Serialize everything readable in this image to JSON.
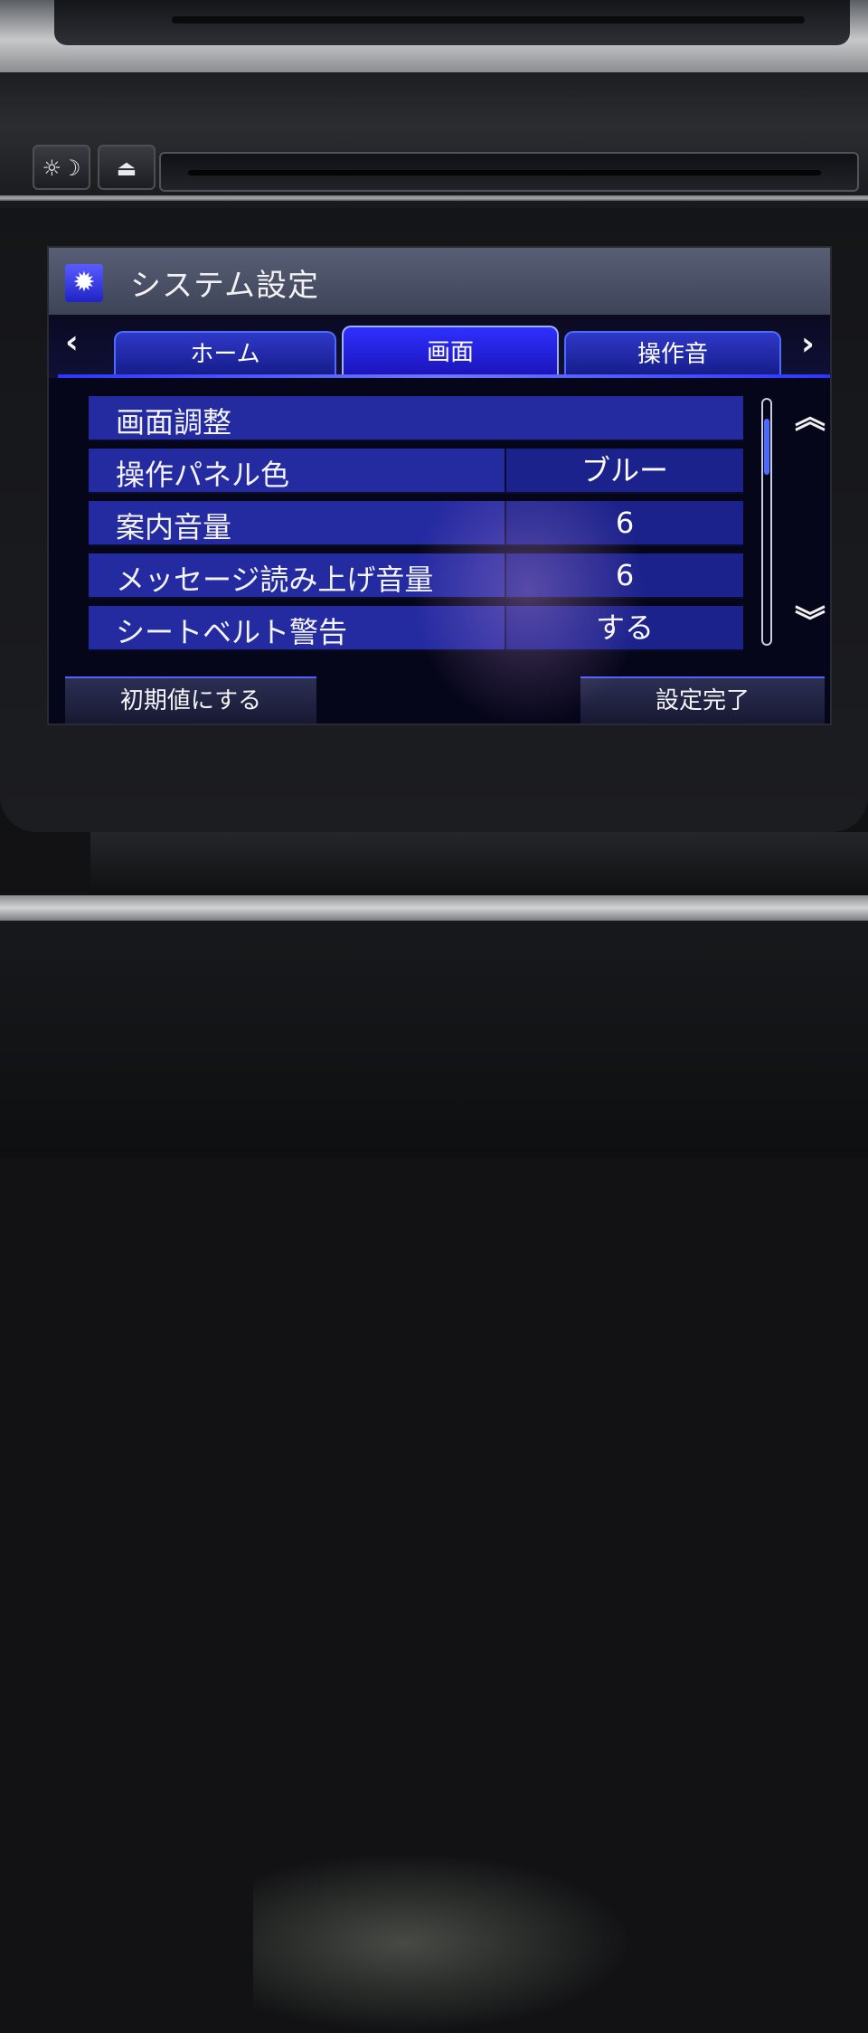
{
  "hardware": {
    "daynight_icon": "☼☽",
    "eject_icon": "⏏"
  },
  "screen": {
    "title": "システム設定",
    "title_icon": "gear-icon",
    "tabs": [
      {
        "label": "ホーム",
        "active": false
      },
      {
        "label": "画面",
        "active": true
      },
      {
        "label": "操作音",
        "active": false
      }
    ],
    "tab_prev_icon": "‹",
    "tab_next_icon": "›",
    "rows": [
      {
        "label": "画面調整",
        "value": ""
      },
      {
        "label": "操作パネル色",
        "value": "ブルー"
      },
      {
        "label": "案内音量",
        "value": "6"
      },
      {
        "label": "メッセージ読み上げ音量",
        "value": "6"
      },
      {
        "label": "シートベルト警告",
        "value": "する"
      }
    ],
    "page_up_icon": "︽",
    "page_down_icon": "︾",
    "reset_button": "初期値にする",
    "done_button": "設定完了",
    "scroll_position": 0.1
  },
  "colors": {
    "accent": "#2e30ff",
    "row_bg": "#242aa0",
    "title_bg": "#4a5068"
  }
}
